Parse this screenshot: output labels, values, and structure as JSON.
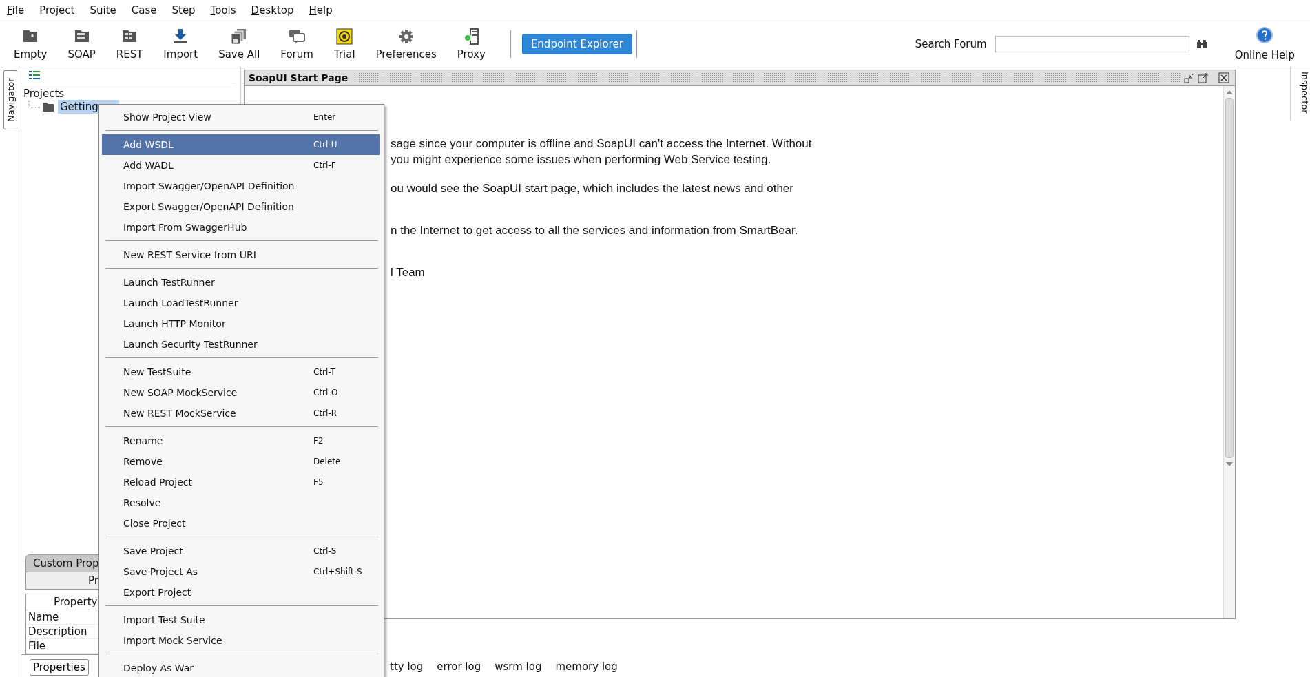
{
  "menubar": [
    {
      "label": "File",
      "mnemonic": true
    },
    {
      "label": "Project",
      "mnemonic": false
    },
    {
      "label": "Suite",
      "mnemonic": false
    },
    {
      "label": "Case",
      "mnemonic": false
    },
    {
      "label": "Step",
      "mnemonic": false
    },
    {
      "label": "Tools",
      "mnemonic": true
    },
    {
      "label": "Desktop",
      "mnemonic": true
    },
    {
      "label": "Help",
      "mnemonic": true
    }
  ],
  "toolbar": [
    {
      "label": "Empty",
      "kind": "empty"
    },
    {
      "label": "SOAP",
      "kind": "soap"
    },
    {
      "label": "REST",
      "kind": "rest"
    },
    {
      "label": "Import",
      "kind": "import"
    },
    {
      "label": "Save All",
      "kind": "saveall"
    },
    {
      "label": "Forum",
      "kind": "forum"
    },
    {
      "label": "Trial",
      "kind": "trial"
    },
    {
      "label": "Preferences",
      "kind": "gear"
    },
    {
      "label": "Proxy",
      "kind": "proxy"
    }
  ],
  "endpoint_button": "Endpoint Explorer",
  "search": {
    "label": "Search Forum"
  },
  "help": {
    "label": "Online Help"
  },
  "navigator": {
    "tab": "Navigator",
    "tree": {
      "label": "Projects",
      "children": [
        {
          "label": "Getting",
          "selected": true
        }
      ]
    }
  },
  "properties_panel": {
    "tabs": [
      "Custom Prop",
      "Pr"
    ],
    "column": "Property",
    "rows": [
      "Name",
      "Description",
      "File"
    ],
    "button": "Properties"
  },
  "start_page": {
    "title": "SoapUI Start Page",
    "paragraphs": [
      [
        "sage since your computer is offline and SoapUI can't access the Internet. Without",
        " you might experience some issues when performing Web Service testing."
      ],
      [
        "ou would see the SoapUI start page, which includes the latest news and other"
      ],
      [
        "n the Internet to get access to all the services and information from SmartBear."
      ],
      [
        "l Team"
      ]
    ]
  },
  "log_tabs": [
    "tty log",
    "error log",
    "wsrm log",
    "memory log"
  ],
  "inspector": {
    "tab": "Inspector"
  },
  "context_menu": [
    [
      {
        "label": "Show Project View",
        "shortcut": "Enter",
        "selected": false
      }
    ],
    [
      {
        "label": "Add WSDL",
        "shortcut": "Ctrl-U",
        "selected": true
      },
      {
        "label": "Add WADL",
        "shortcut": "Ctrl-F",
        "selected": false
      },
      {
        "label": "Import Swagger/OpenAPI Definition",
        "selected": false
      },
      {
        "label": "Export Swagger/OpenAPI Definition",
        "selected": false
      },
      {
        "label": "Import From SwaggerHub",
        "selected": false
      }
    ],
    [
      {
        "label": "New REST Service from URI",
        "selected": false
      }
    ],
    [
      {
        "label": "Launch TestRunner",
        "selected": false
      },
      {
        "label": "Launch LoadTestRunner",
        "selected": false
      },
      {
        "label": "Launch HTTP Monitor",
        "selected": false
      },
      {
        "label": "Launch Security TestRunner",
        "selected": false
      }
    ],
    [
      {
        "label": "New TestSuite",
        "shortcut": "Ctrl-T",
        "selected": false
      },
      {
        "label": "New SOAP MockService",
        "shortcut": "Ctrl-O",
        "selected": false
      },
      {
        "label": "New REST MockService",
        "shortcut": "Ctrl-R",
        "selected": false
      }
    ],
    [
      {
        "label": "Rename",
        "shortcut": "F2",
        "selected": false
      },
      {
        "label": "Remove",
        "shortcut": "Delete",
        "selected": false
      },
      {
        "label": "Reload Project",
        "shortcut": "F5",
        "selected": false
      },
      {
        "label": "Resolve",
        "selected": false
      },
      {
        "label": "Close Project",
        "selected": false
      }
    ],
    [
      {
        "label": "Save Project",
        "shortcut": "Ctrl-S",
        "selected": false
      },
      {
        "label": "Save Project As",
        "shortcut": "Ctrl+Shift-S",
        "selected": false
      },
      {
        "label": "Export Project",
        "selected": false
      }
    ],
    [
      {
        "label": "Import Test Suite",
        "selected": false
      },
      {
        "label": "Import Mock Service",
        "selected": false
      }
    ],
    [
      {
        "label": "Deploy As War",
        "selected": false
      }
    ]
  ]
}
